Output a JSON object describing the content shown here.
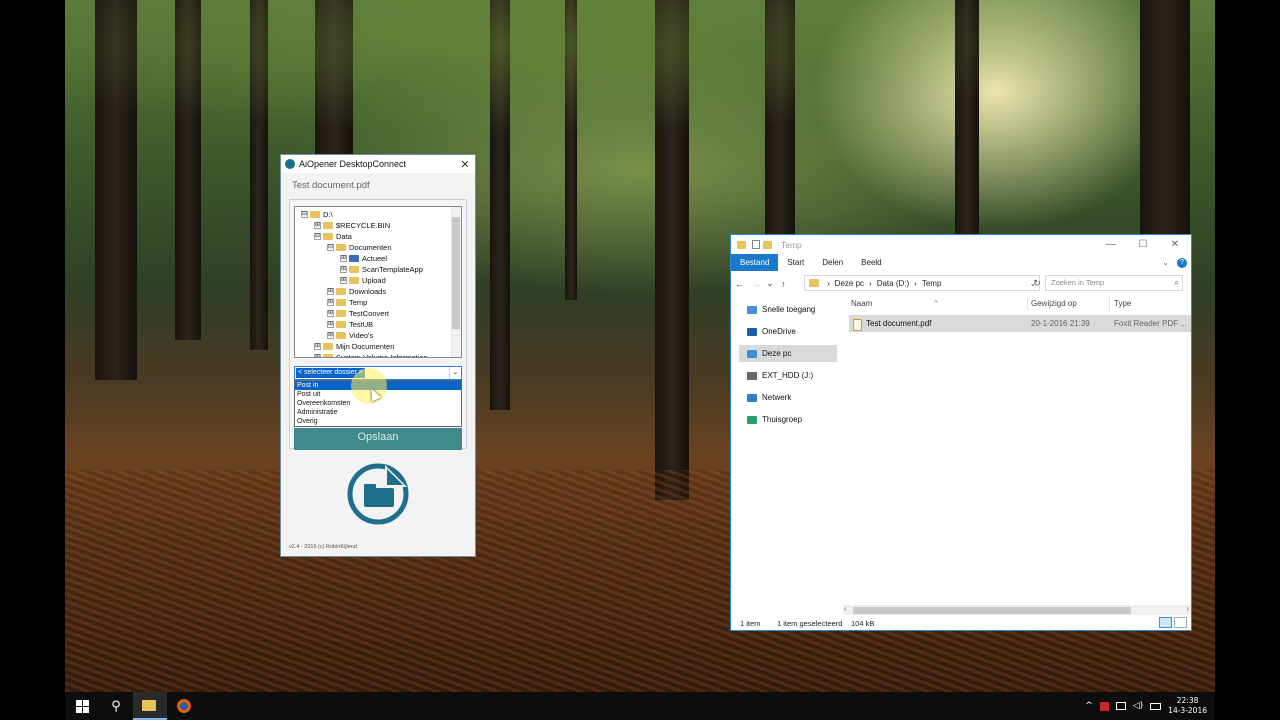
{
  "aiopener": {
    "title": "AiOpener DesktopConnect",
    "close": "✕",
    "file_name": "Test document.pdf",
    "tree": [
      {
        "label": "D:\\",
        "toggle": "⊟",
        "level": 0,
        "icon": "folder"
      },
      {
        "label": "$RECYCLE.BIN",
        "toggle": "⊞",
        "level": 1,
        "icon": "folder"
      },
      {
        "label": "Data",
        "toggle": "⊟",
        "level": 1,
        "icon": "folder"
      },
      {
        "label": "Documenten",
        "toggle": "⊟",
        "level": 2,
        "icon": "folder"
      },
      {
        "label": "Actueel",
        "toggle": "⊞",
        "level": 3,
        "icon": "folder-blue"
      },
      {
        "label": "ScanTemplateApp",
        "toggle": "⊞",
        "level": 3,
        "icon": "folder"
      },
      {
        "label": "Upload",
        "toggle": "⊞",
        "level": 3,
        "icon": "folder"
      },
      {
        "label": "Downloads",
        "toggle": "⊞",
        "level": 2,
        "icon": "folder"
      },
      {
        "label": "Temp",
        "toggle": "⊞",
        "level": 2,
        "icon": "folder"
      },
      {
        "label": "TestConvert",
        "toggle": "⊞",
        "level": 2,
        "icon": "folder"
      },
      {
        "label": "TestUB",
        "toggle": "⊞",
        "level": 2,
        "icon": "folder"
      },
      {
        "label": "Video's",
        "toggle": "⊞",
        "level": 2,
        "icon": "folder"
      },
      {
        "label": "Mijn Documenten",
        "toggle": "⊞",
        "level": 1,
        "icon": "folder"
      },
      {
        "label": "System Volume Information",
        "toggle": "⊞",
        "level": 1,
        "icon": "folder"
      }
    ],
    "combo_value": "< selecteer dossier >",
    "combo_arrow": "⌄",
    "dropdown_options": [
      "Post in",
      "Post uit",
      "Overeenkomsten",
      "Administratie",
      "Overig"
    ],
    "selected_option": "Post in",
    "save_label": "Opslaan",
    "version": "v2.4 - 2016 (c) RobinKijlend",
    "brand_color": "#1e6e8c"
  },
  "explorer": {
    "title": "Temp",
    "window_controls": {
      "minimize": "—",
      "maximize": "☐",
      "close": "✕"
    },
    "ribbon_tabs": [
      "Bestand",
      "Start",
      "Delen",
      "Beeld"
    ],
    "ribbon_expand": "⌄",
    "help": "?",
    "nav_buttons": {
      "back": "←",
      "forward": "→",
      "recent": "⌄",
      "up": "↑"
    },
    "breadcrumb": [
      "Deze pc",
      "Data (D:)",
      "Temp"
    ],
    "breadcrumb_sep": "›",
    "address_dropdown": "⌄",
    "refresh": "↻",
    "search_placeholder": "Zoeken in Temp",
    "search_icon": "⌕",
    "nav_items": [
      {
        "label": "Snelle toegang",
        "icon": "star-icon",
        "selected": false
      },
      {
        "label": "OneDrive",
        "icon": "cloud-icon",
        "selected": false
      },
      {
        "label": "Deze pc",
        "icon": "computer-icon",
        "selected": true
      },
      {
        "label": "EXT_HDD (J:)",
        "icon": "drive-icon",
        "selected": false
      },
      {
        "label": "Netwerk",
        "icon": "network-icon",
        "selected": false
      },
      {
        "label": "Thuisgroep",
        "icon": "homegroup-icon",
        "selected": false
      }
    ],
    "columns": {
      "name": "Naam",
      "modified": "Gewijzigd op",
      "type": "Type"
    },
    "sort_caret": "^",
    "files": [
      {
        "name": "Test document.pdf",
        "modified": "20-1-2016 21:39",
        "type": "Foxit Reader PDF ..."
      }
    ],
    "status": {
      "count": "1 item",
      "selection": "1 item geselecteerd",
      "size": "104 kB"
    },
    "accent": "#1979ca"
  },
  "taskbar": {
    "search_icon": "⚲",
    "tray_chevron": "^",
    "time": "22:38",
    "date": "14-3-2016"
  }
}
